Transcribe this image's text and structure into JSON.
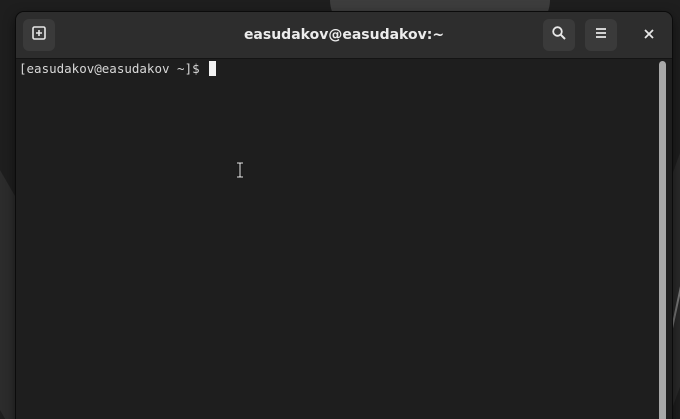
{
  "window": {
    "title": "easudakov@easudakov:~"
  },
  "titlebar": {
    "new_tab_icon": "new-tab-icon",
    "search_icon": "search-icon",
    "menu_icon": "hamburger-menu-icon",
    "close_icon": "close-icon"
  },
  "terminal": {
    "prompt": "[easudakov@easudakov ~]$ "
  },
  "colors": {
    "titlebar_bg": "#2d2d2d",
    "terminal_bg": "#1e1e1e",
    "text": "#d8d8d8",
    "button_bg": "#3a3a3a"
  }
}
